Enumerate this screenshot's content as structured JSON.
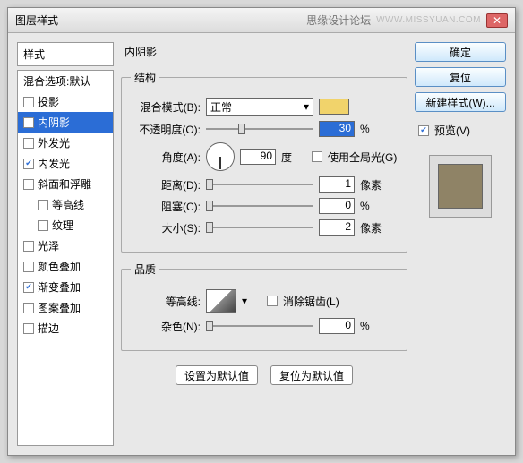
{
  "window": {
    "title": "图层样式",
    "forum": "思缘设计论坛",
    "watermark": "WWW.MISSYUAN.COM"
  },
  "stylesPanel": {
    "header": "样式",
    "blending": "混合选项:默认",
    "items": [
      {
        "label": "投影",
        "checked": false,
        "selected": false,
        "indent": false
      },
      {
        "label": "内阴影",
        "checked": true,
        "selected": true,
        "indent": false
      },
      {
        "label": "外发光",
        "checked": false,
        "selected": false,
        "indent": false
      },
      {
        "label": "内发光",
        "checked": true,
        "selected": false,
        "indent": false
      },
      {
        "label": "斜面和浮雕",
        "checked": false,
        "selected": false,
        "indent": false
      },
      {
        "label": "等高线",
        "checked": false,
        "selected": false,
        "indent": true
      },
      {
        "label": "纹理",
        "checked": false,
        "selected": false,
        "indent": true
      },
      {
        "label": "光泽",
        "checked": false,
        "selected": false,
        "indent": false
      },
      {
        "label": "颜色叠加",
        "checked": false,
        "selected": false,
        "indent": false
      },
      {
        "label": "渐变叠加",
        "checked": true,
        "selected": false,
        "indent": false
      },
      {
        "label": "图案叠加",
        "checked": false,
        "selected": false,
        "indent": false
      },
      {
        "label": "描边",
        "checked": false,
        "selected": false,
        "indent": false
      }
    ]
  },
  "main": {
    "title": "内阴影",
    "structure": {
      "legend": "结构",
      "blendMode": {
        "label": "混合模式(B):",
        "value": "正常",
        "swatch": "#f1d36b"
      },
      "opacity": {
        "label": "不透明度(O):",
        "value": "30",
        "unit": "%",
        "thumbPct": 30
      },
      "angle": {
        "label": "角度(A):",
        "value": "90",
        "unit": "度",
        "useGlobal": "使用全局光(G)",
        "globalChecked": false
      },
      "distance": {
        "label": "距离(D):",
        "value": "1",
        "unit": "像素",
        "thumbPct": 0
      },
      "choke": {
        "label": "阻塞(C):",
        "value": "0",
        "unit": "%",
        "thumbPct": 0
      },
      "size": {
        "label": "大小(S):",
        "value": "2",
        "unit": "像素",
        "thumbPct": 0
      }
    },
    "quality": {
      "legend": "品质",
      "contour": {
        "label": "等高线:",
        "antialias": "消除锯齿(L)",
        "antialiasChecked": false
      },
      "noise": {
        "label": "杂色(N):",
        "value": "0",
        "unit": "%",
        "thumbPct": 0
      }
    },
    "buttons": {
      "setDefault": "设置为默认值",
      "resetDefault": "复位为默认值"
    }
  },
  "rightPanel": {
    "ok": "确定",
    "cancel": "复位",
    "newStyle": "新建样式(W)...",
    "preview": {
      "label": "预览(V)",
      "checked": true
    }
  }
}
